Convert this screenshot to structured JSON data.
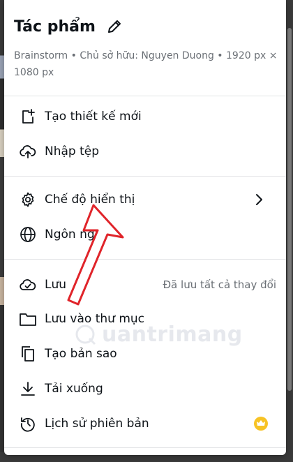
{
  "header": {
    "title": "Tác phẩm",
    "meta": "Brainstorm • Chủ sở hữu: Nguyen Duong • 1920 px × 1080 px"
  },
  "menu": {
    "create_new": "Tạo thiết kế mới",
    "import": "Nhập tệp",
    "view_mode": "Chế độ hiển thị",
    "language": "Ngôn ngữ",
    "save": "Lưu",
    "save_status": "Đã lưu tất cả thay đổi",
    "save_to_folder": "Lưu vào thư mục",
    "make_copy": "Tạo bản sao",
    "download": "Tải xuống",
    "version_history": "Lịch sử phiên bản"
  },
  "watermark": {
    "text": "uantrimang"
  },
  "colors": {
    "text": "#0e1318",
    "muted": "#6a6f75",
    "divider": "#e3e4e6",
    "crown": "#f7c325",
    "annotation_arrow": "#e0242a"
  }
}
